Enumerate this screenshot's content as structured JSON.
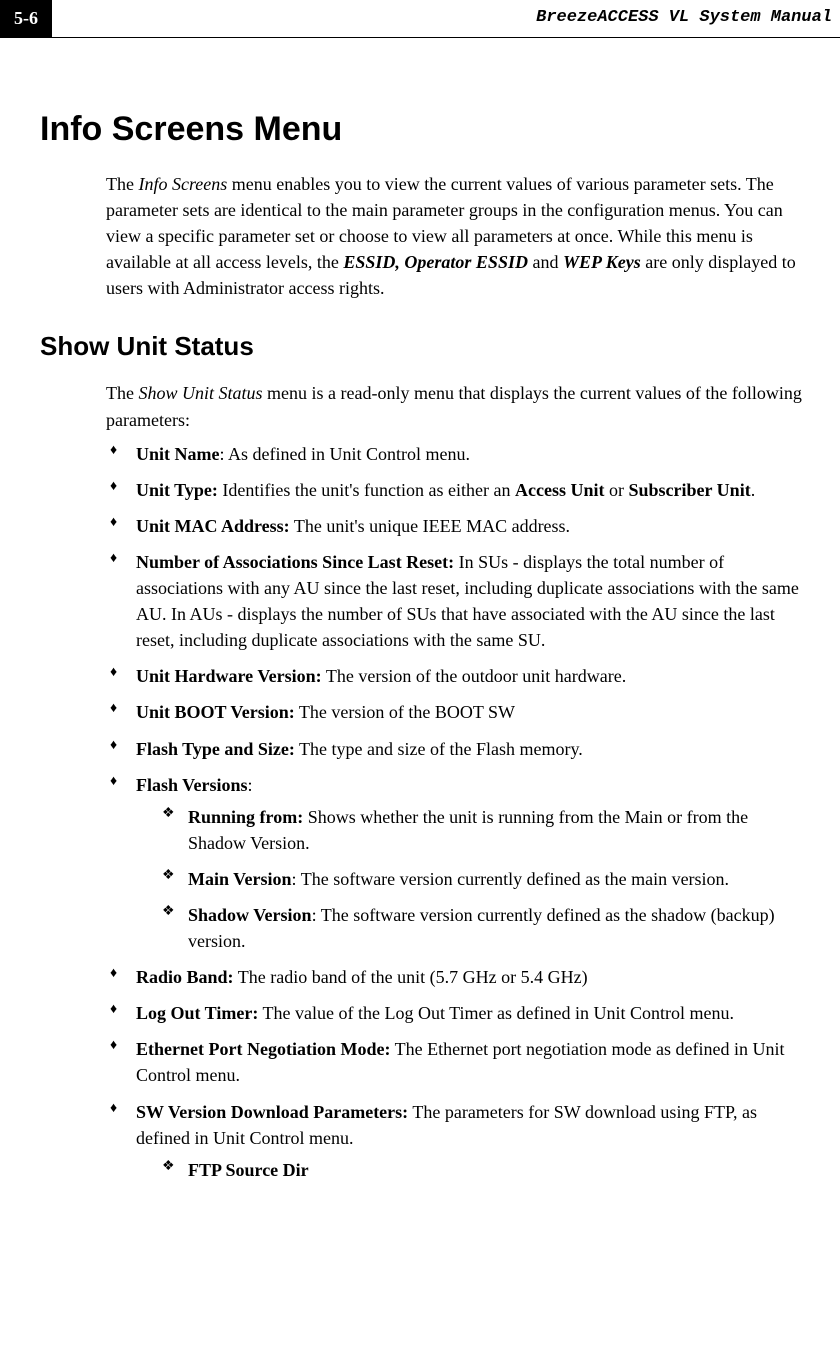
{
  "header": {
    "page_num": "5-6",
    "doc_title": "BreezeACCESS VL System Manual"
  },
  "h1": "Info Screens Menu",
  "intro_parts": {
    "p1a": "The ",
    "p1b": "Info Screens",
    "p1c": " menu enables you to view the current values of various parameter sets. The parameter sets are identical to the main parameter groups in the configuration menus. You can view a specific parameter set or choose to view all parameters at once. While this menu is available at all access levels, the ",
    "p1d": "ESSID, Operator ESSID",
    "p1e": " and ",
    "p1f": "WEP Keys",
    "p1g": " are only displayed to users with Administrator access rights."
  },
  "h2": "Show Unit Status",
  "p2": {
    "a": "The ",
    "b": "Show Unit Status",
    "c": " menu is a read-only menu that displays the current values of the following parameters:"
  },
  "items": {
    "i0": {
      "label": "Unit Name",
      "rest": ": As defined in Unit Control menu."
    },
    "i1": {
      "label": "Unit Type:",
      "rest_a": " Identifies the unit's function as either an ",
      "b1": "Access Unit",
      "rest_b": " or ",
      "b2": "Subscriber Unit",
      "rest_c": "."
    },
    "i2": {
      "label": "Unit MAC Address:",
      "rest": " The unit's unique IEEE MAC address."
    },
    "i3": {
      "label": "Number of Associations Since Last Reset:",
      "rest": " In SUs - displays the total number of associations with any AU since the last reset, including duplicate associations with the same AU. In AUs - displays the number of SUs that have associated with the AU since the last reset, including duplicate associations with the same SU."
    },
    "i4": {
      "label": "Unit Hardware Version:",
      "rest": " The version of the outdoor unit hardware."
    },
    "i5": {
      "label": "Unit BOOT Version:",
      "rest": " The version of the BOOT SW"
    },
    "i6": {
      "label": "Flash Type and Size:",
      "rest": " The type and size of the Flash memory."
    },
    "i7": {
      "label": "Flash Versions",
      "rest": ":"
    },
    "i8": {
      "label": "Radio Band:",
      "rest": " The radio band of the unit (5.7 GHz or 5.4 GHz)"
    },
    "i9": {
      "label": "Log Out Timer:",
      "rest": " The value of the Log Out Timer as defined in Unit Control menu."
    },
    "i10": {
      "label": "Ethernet Port Negotiation Mode:",
      "rest": " The Ethernet port negotiation mode as defined in Unit Control menu."
    },
    "i11": {
      "label": "SW Version Download Parameters:",
      "rest": " The parameters for SW download using FTP, as defined in Unit Control menu."
    }
  },
  "sub": {
    "s0": {
      "label": "Running from:",
      "rest": " Shows whether the unit is running from the Main or from the Shadow Version."
    },
    "s1": {
      "label": "Main Version",
      "rest": ": The software version currently defined as the main version."
    },
    "s2": {
      "label": "Shadow Version",
      "rest": ": The software version currently defined as the shadow (backup) version."
    },
    "s3": {
      "label": "FTP Source Dir"
    }
  }
}
